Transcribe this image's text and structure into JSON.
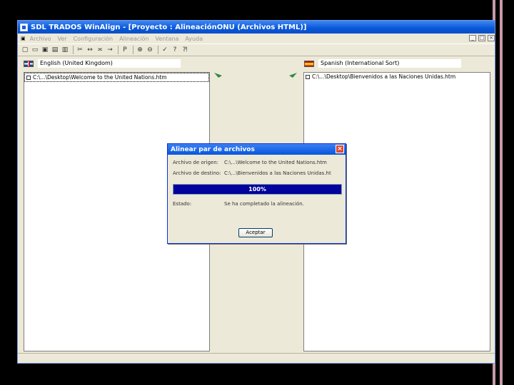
{
  "window": {
    "title": "SDL TRADOS WinAlign - [Proyecto : AlineaciónONU (Archivos HTML)]"
  },
  "menubar": {
    "items": [
      "Archivo",
      "Ver",
      "Configuración",
      "Alineación",
      "Ventana",
      "Ayuda"
    ]
  },
  "toolbar": {
    "text_buttons": [
      "P"
    ]
  },
  "source": {
    "language": "English (United Kingdom)",
    "file": "C:\\...\\Desktop\\Welcome to the United Nations.htm"
  },
  "target": {
    "language": "Spanish (International Sort)",
    "file": "C:\\...\\Desktop\\Bienvenidos a las Naciones Unidas.htm"
  },
  "dialog": {
    "title": "Alinear par de archivos",
    "source_label": "Archivo de origen:",
    "source_value": "C:\\...\\Welcome to the United Nations.htm",
    "target_label": "Archivo de destino:",
    "target_value": "C:\\...\\Bienvenidos a las Naciones Unidas.ht",
    "progress_text": "100%",
    "progress_fraction": 1.0,
    "status_label": "Estado:",
    "status_value": "Se ha completado la alineación.",
    "close_button": "Aceptar"
  },
  "colors": {
    "progress_fill": "#02029c",
    "title_bar": "#0a57d6"
  }
}
